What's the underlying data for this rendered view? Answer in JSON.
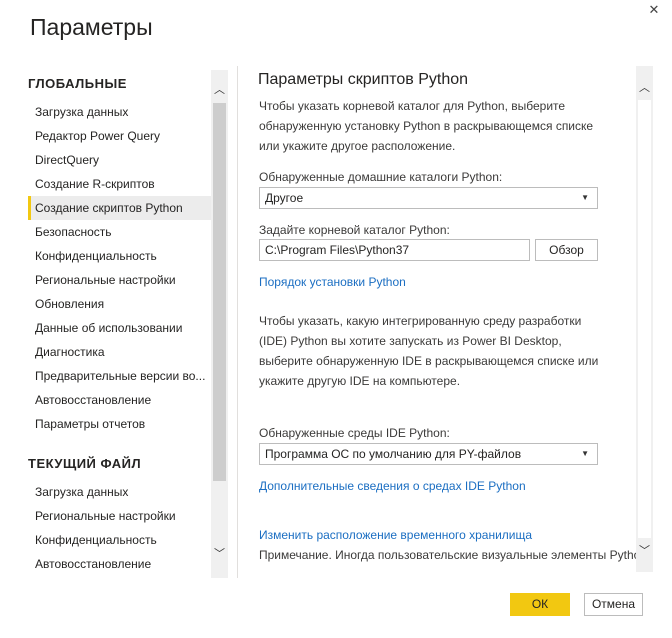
{
  "dialog": {
    "title": "Параметры",
    "close_glyph": "✕"
  },
  "sidebar": {
    "global_header": "ГЛОБАЛЬНЫЕ",
    "global_items": [
      {
        "label": "Загрузка данных"
      },
      {
        "label": "Редактор Power Query"
      },
      {
        "label": "DirectQuery"
      },
      {
        "label": "Создание R-скриптов"
      },
      {
        "label": "Создание скриптов Python",
        "selected": true
      },
      {
        "label": "Безопасность"
      },
      {
        "label": "Конфиденциальность"
      },
      {
        "label": "Региональные настройки"
      },
      {
        "label": "Обновления"
      },
      {
        "label": "Данные об использовании"
      },
      {
        "label": "Диагностика"
      },
      {
        "label": "Предварительные версии во..."
      },
      {
        "label": "Автовосстановление"
      },
      {
        "label": "Параметры отчетов"
      }
    ],
    "current_header": "ТЕКУЩИЙ ФАЙЛ",
    "current_items": [
      {
        "label": "Загрузка данных"
      },
      {
        "label": "Региональные настройки"
      },
      {
        "label": "Конфиденциальность"
      },
      {
        "label": "Автовосстановление"
      }
    ],
    "scroll_up_glyph": "︿",
    "scroll_down_glyph": "﹀"
  },
  "content": {
    "title": "Параметры скриптов Python",
    "intro": "Чтобы указать корневой каталог для Python, выберите обнаруженную установку Python в раскрывающемся списке или укажите другое расположение.",
    "detected_home_label": "Обнаруженные домашние каталоги Python:",
    "detected_home_value": "Другое",
    "root_dir_label": "Задайте корневой каталог Python:",
    "root_dir_value": "C:\\Program Files\\Python37",
    "browse_label": "Обзор",
    "install_order_link": "Порядок установки Python",
    "ide_intro": "Чтобы указать, какую интегрированную среду разработки (IDE) Python вы хотите запускать из Power BI Desktop, выберите обнаруженную IDE в раскрывающемся списке или укажите другую IDE на компьютере.",
    "detected_ide_label": "Обнаруженные среды IDE Python:",
    "detected_ide_value": "Программа ОС по умолчанию для PY-файлов",
    "ide_more_link": "Дополнительные сведения о средах IDE Python",
    "change_temp_link": "Изменить расположение временного хранилища",
    "note": "Примечание. Иногда пользовательские визуальные элементы Python",
    "dropdown_glyph": "▼",
    "scroll_up_glyph": "︿",
    "scroll_down_glyph": "﹀"
  },
  "footer": {
    "ok_label": "ОК",
    "cancel_label": "Отмена"
  },
  "colors": {
    "accent": "#f2c811",
    "link": "#1b6ec2",
    "selected_bg": "#ececec"
  }
}
